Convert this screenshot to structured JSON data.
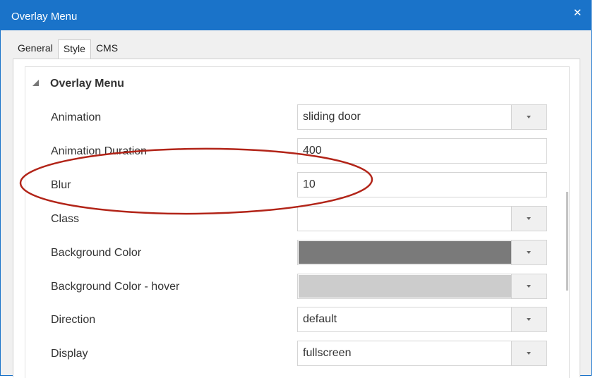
{
  "window": {
    "title": "Overlay Menu",
    "close_glyph": "✕"
  },
  "tabs": [
    {
      "label": "General",
      "active": false
    },
    {
      "label": "Style",
      "active": true
    },
    {
      "label": "CMS",
      "active": false
    }
  ],
  "group": {
    "title": "Overlay Menu",
    "expanded": true
  },
  "rows": [
    {
      "label": "Animation",
      "value": "sliding door",
      "type": "dropdown"
    },
    {
      "label": "Animation Duration",
      "value": "400",
      "type": "text"
    },
    {
      "label": "Blur",
      "value": "10",
      "type": "text"
    },
    {
      "label": "Class",
      "value": "",
      "type": "dropdown"
    },
    {
      "label": "Background Color",
      "value": "",
      "type": "color-dropdown",
      "color": "#7a7a7a"
    },
    {
      "label": "Background Color - hover",
      "value": "",
      "type": "color-dropdown",
      "color": "#cccccc"
    },
    {
      "label": "Direction",
      "value": "default",
      "type": "dropdown"
    },
    {
      "label": "Display",
      "value": "fullscreen",
      "type": "dropdown"
    }
  ],
  "colors": {
    "titlebar": "#1a73c9",
    "annotation_ellipse": "#b22418"
  }
}
